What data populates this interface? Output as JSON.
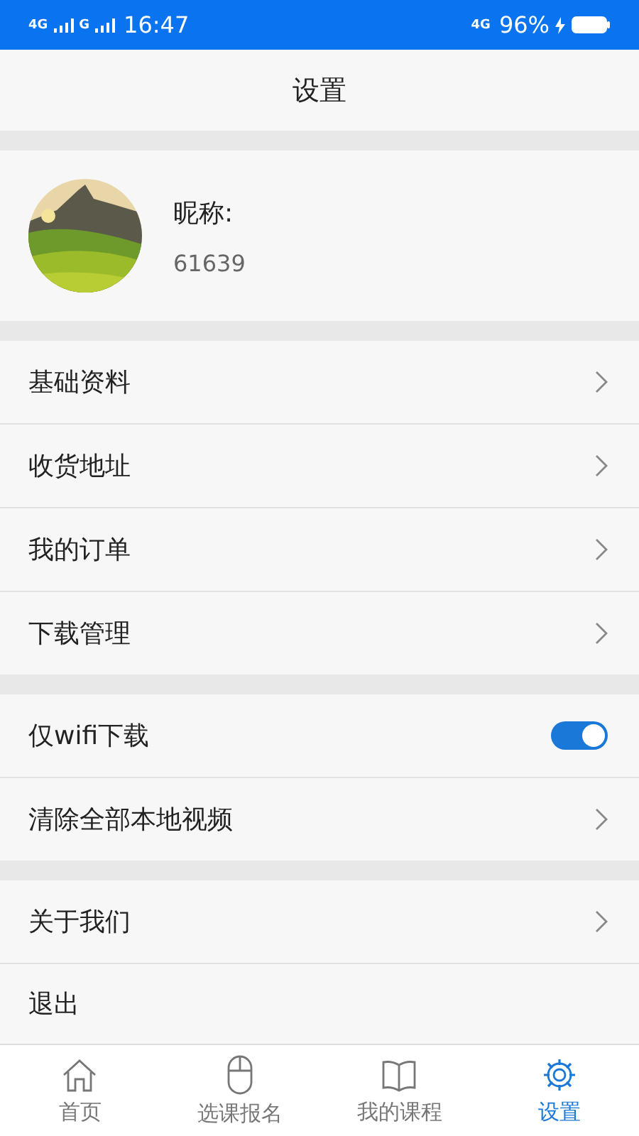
{
  "status_bar": {
    "left_network_1": "4G",
    "left_network_2": "G",
    "time": "16:47",
    "right_network": "4G",
    "battery": "96%"
  },
  "header": {
    "title": "设置"
  },
  "profile": {
    "nickname_label": "昵称:",
    "nickname": "61639"
  },
  "groups": [
    {
      "items": [
        {
          "label": "基础资料",
          "kind": "link"
        },
        {
          "label": "收货地址",
          "kind": "link"
        },
        {
          "label": "我的订单",
          "kind": "link"
        },
        {
          "label": "下载管理",
          "kind": "link"
        }
      ]
    },
    {
      "items": [
        {
          "label": "仅wifi下载",
          "kind": "toggle",
          "on": true
        },
        {
          "label": "清除全部本地视频",
          "kind": "link"
        }
      ]
    },
    {
      "items": [
        {
          "label": "关于我们",
          "kind": "link"
        },
        {
          "label": "退出",
          "kind": "plain"
        }
      ]
    }
  ],
  "tabs": [
    {
      "label": "首页",
      "kind": "home",
      "selected": false
    },
    {
      "label": "选课报名",
      "kind": "mouse",
      "selected": false
    },
    {
      "label": "我的课程",
      "kind": "book",
      "selected": false
    },
    {
      "label": "设置",
      "kind": "gear",
      "selected": true
    }
  ]
}
